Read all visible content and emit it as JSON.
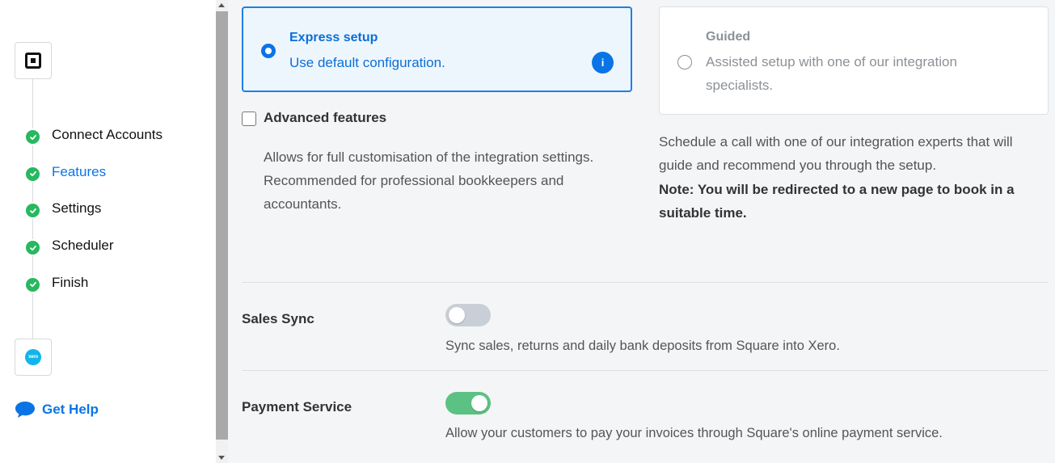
{
  "sidebar": {
    "app_top_icon": "square-logo-icon",
    "app_bottom_icon": "xero-logo-icon",
    "app_bottom_text": "xero",
    "steps": [
      {
        "label": "Connect Accounts",
        "done": true,
        "active": false
      },
      {
        "label": "Features",
        "done": true,
        "active": true
      },
      {
        "label": "Settings",
        "done": true,
        "active": false
      },
      {
        "label": "Scheduler",
        "done": true,
        "active": false
      },
      {
        "label": "Finish",
        "done": true,
        "active": false
      }
    ],
    "help_label": "Get Help",
    "help_icon": "chat-bubble-icon"
  },
  "setup": {
    "express": {
      "title": "Express setup",
      "description": "Use default configuration.",
      "selected": true,
      "info_symbol": "i"
    },
    "guided": {
      "title": "Guided",
      "description": "Assisted setup with one of our integration specialists.",
      "selected": false
    },
    "advanced": {
      "label": "Advanced features",
      "checked": false,
      "description": "Allows for full customisation of the integration settings. Recommended for professional bookkeepers and accountants."
    },
    "guided_info": {
      "description": "Schedule a call with one of our integration experts that will guide and recommend you through the setup.",
      "note": "Note: You will be redirected to a new page to book in a suitable time."
    }
  },
  "settings": [
    {
      "label": "Sales Sync",
      "enabled": false,
      "description": "Sync sales, returns and daily bank deposits from Square into Xero."
    },
    {
      "label": "Payment Service",
      "enabled": true,
      "description": "Allow your customers to pay your invoices through Square's online payment service."
    }
  ],
  "colors": {
    "accent": "#0a74e6",
    "success": "#28b85f",
    "toggle_on": "#5cc283",
    "toggle_off": "#c9cfd6"
  }
}
